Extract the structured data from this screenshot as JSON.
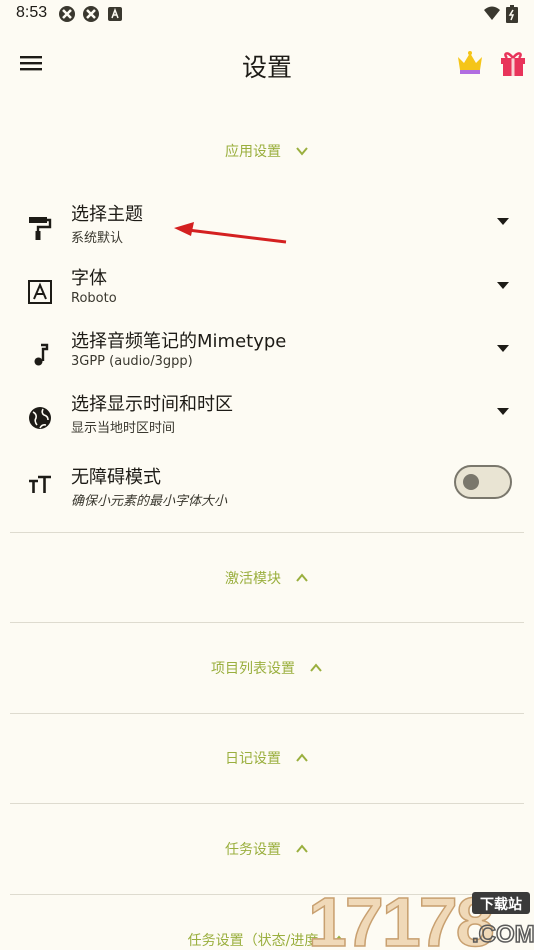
{
  "status_bar": {
    "time": "8:53",
    "icons": [
      "app-notification-icon",
      "app-notification-icon",
      "a-icon",
      "wifi-icon",
      "battery-icon"
    ]
  },
  "app_bar": {
    "title": "设置",
    "left_icon": "menu-icon",
    "right_icons": [
      "crown-icon",
      "gift-icon"
    ]
  },
  "sections": [
    {
      "label": "应用设置",
      "state": "expanded"
    },
    {
      "label": "激活模块",
      "state": "collapsed"
    },
    {
      "label": "项目列表设置",
      "state": "collapsed"
    },
    {
      "label": "日记设置",
      "state": "collapsed"
    },
    {
      "label": "任务设置",
      "state": "collapsed"
    },
    {
      "label": "任务设置（状态/进度",
      "state": "collapsed"
    }
  ],
  "settings": [
    {
      "icon": "paint-roller-icon",
      "title": "选择主题",
      "subtitle": "系统默认"
    },
    {
      "icon": "font-icon",
      "title": "字体",
      "subtitle": "Roboto"
    },
    {
      "icon": "music-note-icon",
      "title": "选择音频笔记的Mimetype",
      "subtitle": "3GPP (audio/3gpp)"
    },
    {
      "icon": "globe-icon",
      "title": "选择显示时间和时区",
      "subtitle": "显示当地时区时间"
    },
    {
      "icon": "text-size-icon",
      "title": "无障碍模式",
      "subtitle": "确保小元素的最小字体大小",
      "toggle": "off"
    }
  ],
  "watermark": {
    "text": "17178",
    "tag": "下载站",
    "domain": ".COM"
  },
  "colors": {
    "background": "#fdfbf3",
    "accent": "#9aaf3e",
    "text": "#1d1b16",
    "divider": "#dedbcf",
    "annotation_arrow": "#d42020",
    "gift": "#e8345a",
    "crown": "#f5c518"
  }
}
